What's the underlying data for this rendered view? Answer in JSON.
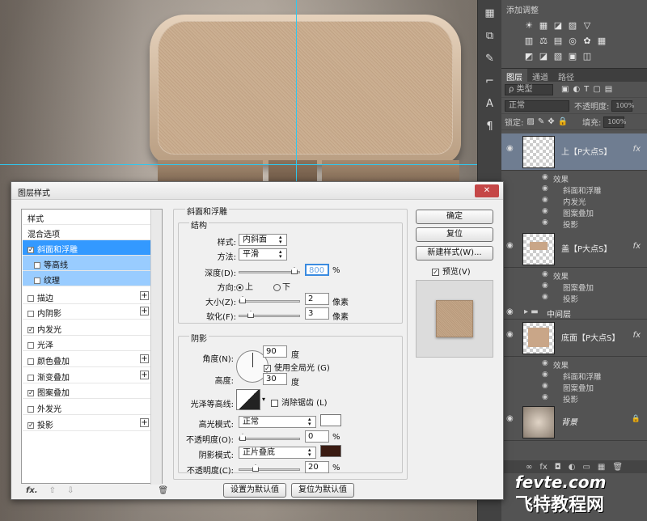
{
  "adjust_panel": {
    "title": "添加调整",
    "rows": [
      [
        "☀",
        "▦",
        "◪",
        "▨",
        "▽"
      ],
      [
        "▥",
        "⚖",
        "▤",
        "◎",
        "✿",
        "▦"
      ],
      [
        "◩",
        "◪",
        "▧",
        "▣",
        "◫"
      ]
    ]
  },
  "layers_panel": {
    "tabs": [
      "图层",
      "通道",
      "路径"
    ],
    "filter_label": "ρ 类型",
    "blend_mode": "正常",
    "opacity_label": "不透明度:",
    "opacity_value": "100%",
    "lock_label": "锁定:",
    "fill_label": "填充:",
    "fill_value": "100%",
    "layers": [
      {
        "name": "上【P大点S】",
        "fx": "fx",
        "effects_label": "效果",
        "effects": [
          "斜面和浮雕",
          "内发光",
          "图案叠加",
          "投影"
        ]
      },
      {
        "name": "盖【P大点S】",
        "fx": "fx",
        "effects_label": "效果",
        "effects": [
          "图案叠加",
          "投影"
        ]
      },
      {
        "name": "中间层",
        "group": true
      },
      {
        "name": "底面【P大点S】",
        "fx": "fx",
        "effects_label": "效果",
        "effects": [
          "斜面和浮雕",
          "图案叠加",
          "投影"
        ]
      },
      {
        "name": "背景",
        "lock": "🔒"
      }
    ],
    "footer_icons": [
      "∞",
      "fx",
      "◘",
      "◐",
      "▭",
      "▦",
      "🗑"
    ]
  },
  "watermark": {
    "line1": "fevte.com",
    "line2": "飞特教程网"
  },
  "dialog": {
    "title": "图层样式",
    "close_label": "✕",
    "styles": [
      {
        "label": "样式",
        "checkbox": false
      },
      {
        "label": "混合选项",
        "checkbox": false
      },
      {
        "label": "斜面和浮雕",
        "checkbox": true,
        "checked": true,
        "state": "active"
      },
      {
        "label": "等高线",
        "checkbox": true,
        "checked": false,
        "state": "sub"
      },
      {
        "label": "纹理",
        "checkbox": true,
        "checked": false,
        "state": "sub"
      },
      {
        "label": "描边",
        "checkbox": true,
        "checked": false,
        "plus": true
      },
      {
        "label": "内阴影",
        "checkbox": true,
        "checked": false,
        "plus": true
      },
      {
        "label": "内发光",
        "checkbox": true,
        "checked": true
      },
      {
        "label": "光泽",
        "checkbox": true,
        "checked": false
      },
      {
        "label": "颜色叠加",
        "checkbox": true,
        "checked": false,
        "plus": true
      },
      {
        "label": "渐变叠加",
        "checkbox": true,
        "checked": false,
        "plus": true
      },
      {
        "label": "图案叠加",
        "checkbox": true,
        "checked": true
      },
      {
        "label": "外发光",
        "checkbox": true,
        "checked": false
      },
      {
        "label": "投影",
        "checkbox": true,
        "checked": true,
        "plus": true
      }
    ],
    "footer_icons": [
      "fx.",
      "⇧",
      "⇩",
      "🗑"
    ],
    "bevel": {
      "group_title": "斜面和浮雕",
      "structure_title": "结构",
      "style_label": "样式:",
      "style_value": "内斜面",
      "technique_label": "方法:",
      "technique_value": "平滑",
      "depth_label": "深度(D):",
      "depth_value": "800",
      "depth_unit": "%",
      "direction_label": "方向:",
      "dir_up": "上",
      "dir_down": "下",
      "size_label": "大小(Z):",
      "size_value": "2",
      "size_unit": "像素",
      "soften_label": "软化(F):",
      "soften_value": "3",
      "soften_unit": "像素",
      "shading_title": "阴影",
      "angle_label": "角度(N):",
      "angle_value": "90",
      "angle_unit": "度",
      "global_light_label": "使用全局光 (G)",
      "altitude_label": "高度:",
      "altitude_value": "30",
      "altitude_unit": "度",
      "gloss_label": "光泽等高线:",
      "antialias_label": "消除锯齿 (L)",
      "highlight_mode_label": "高光模式:",
      "highlight_mode_value": "正常",
      "highlight_color": "#ffffff",
      "hl_opacity_label": "不透明度(O):",
      "hl_opacity_value": "0",
      "hl_opacity_unit": "%",
      "shadow_mode_label": "阴影模式:",
      "shadow_mode_value": "正片叠底",
      "shadow_color": "#3a1b12",
      "sh_opacity_label": "不透明度(C):",
      "sh_opacity_value": "20",
      "sh_opacity_unit": "%",
      "make_default_label": "设置为默认值",
      "reset_default_label": "复位为默认值"
    },
    "buttons": {
      "ok": "确定",
      "reset": "复位",
      "new_style": "新建样式(W)...",
      "preview": "预览(V)"
    }
  }
}
